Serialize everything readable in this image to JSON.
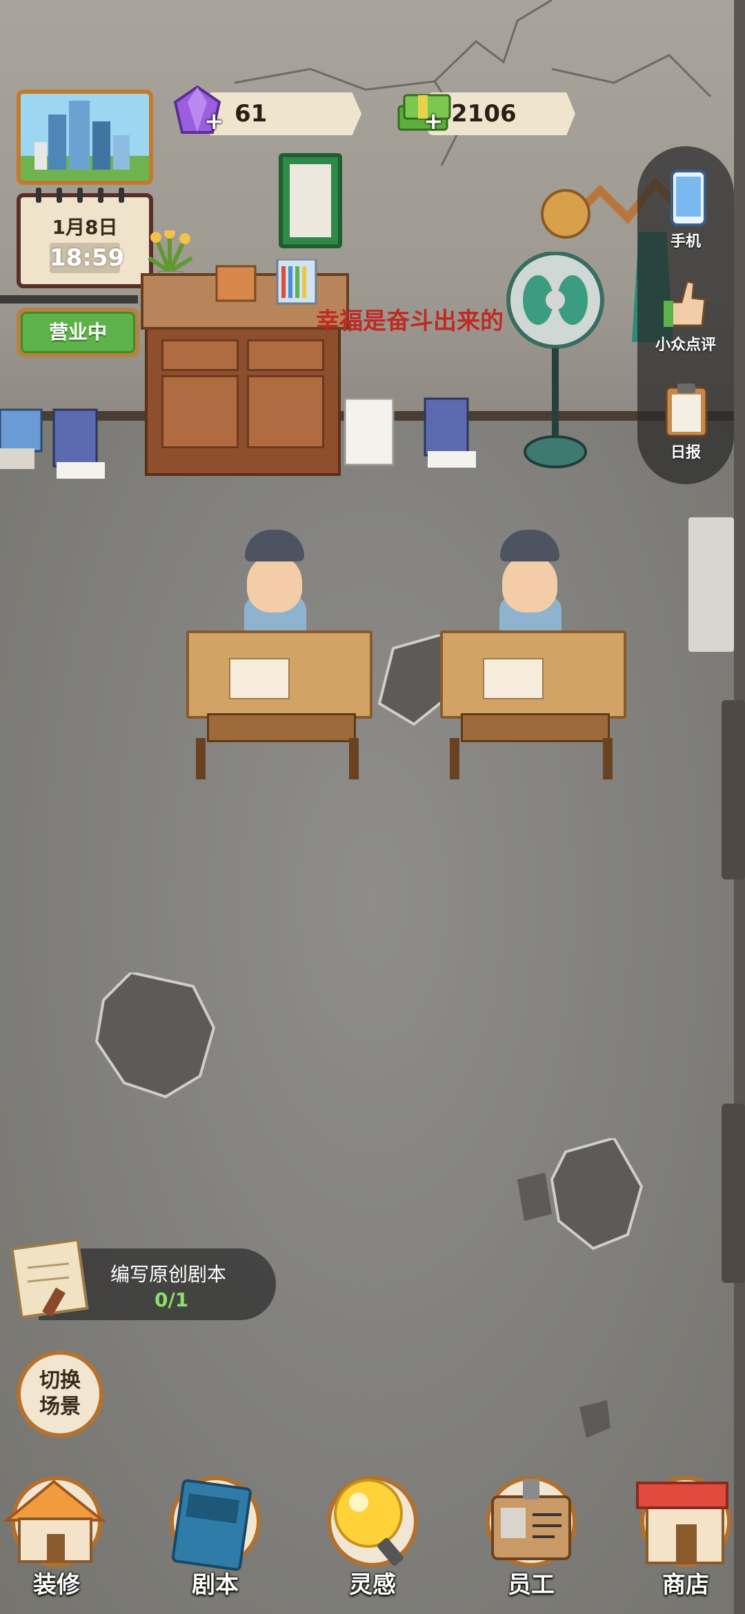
{
  "resources": {
    "gems": "61",
    "cash": "2106",
    "plus": "+"
  },
  "calendar": {
    "date": "1月8日",
    "time": "18:59"
  },
  "status_sign": "营业中",
  "wall_slogan": "幸福是奋斗出来的",
  "side_menu": [
    {
      "label": "手机",
      "icon": "phone-icon"
    },
    {
      "label": "小众点评",
      "icon": "thumbs-up-icon"
    },
    {
      "label": "日报",
      "icon": "clipboard-icon"
    }
  ],
  "quest": {
    "title": "编写原创剧本",
    "progress": "0/1"
  },
  "switch_scene": "切换场景",
  "bottom_nav": [
    {
      "label": "装修",
      "icon": "house-icon"
    },
    {
      "label": "剧本",
      "icon": "script-book-icon"
    },
    {
      "label": "灵感",
      "icon": "lightbulb-icon"
    },
    {
      "label": "员工",
      "icon": "id-badge-icon"
    },
    {
      "label": "商店",
      "icon": "shop-icon"
    }
  ],
  "colors": {
    "accent_wood": "#b3702c",
    "open_green": "#5db349",
    "progress_green": "#8fe06b"
  }
}
